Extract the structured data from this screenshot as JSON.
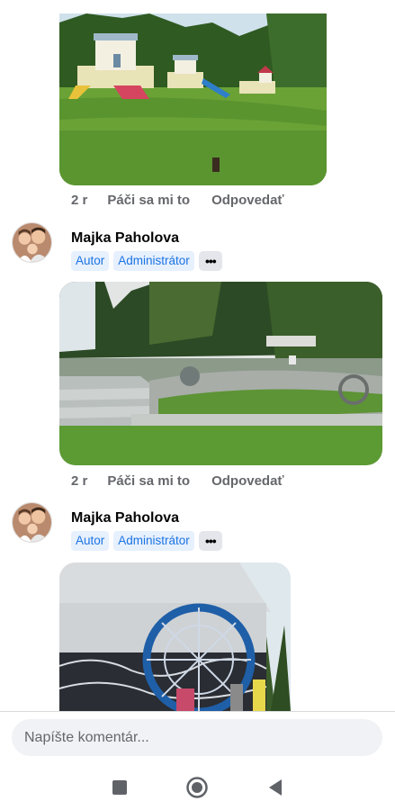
{
  "comments": [
    {
      "id": "c1",
      "photo": "playground-castles",
      "actions": {
        "time": "2 r",
        "like": "Páči sa mi to",
        "reply": "Odpovedať"
      }
    },
    {
      "id": "c2",
      "author": "Majka Paholova",
      "badges": [
        "Autor",
        "Administrátor"
      ],
      "more": "•••",
      "photo": "stone-park",
      "actions": {
        "time": "2 r",
        "like": "Páči sa mi to",
        "reply": "Odpovedať"
      }
    },
    {
      "id": "c3",
      "author": "Majka Paholova",
      "badges": [
        "Autor",
        "Administrátor"
      ],
      "more": "•••",
      "photo": "illuminated-mill"
    }
  ],
  "composer": {
    "placeholder": "Napíšte komentár..."
  },
  "nav": {
    "recents": "square-icon",
    "home": "circle-icon",
    "back": "triangle-back-icon"
  },
  "colors": {
    "badge_bg": "#e7f0fd",
    "badge_text": "#1b74e4",
    "action_text": "#65676b",
    "input_bg": "#f0f2f5"
  }
}
